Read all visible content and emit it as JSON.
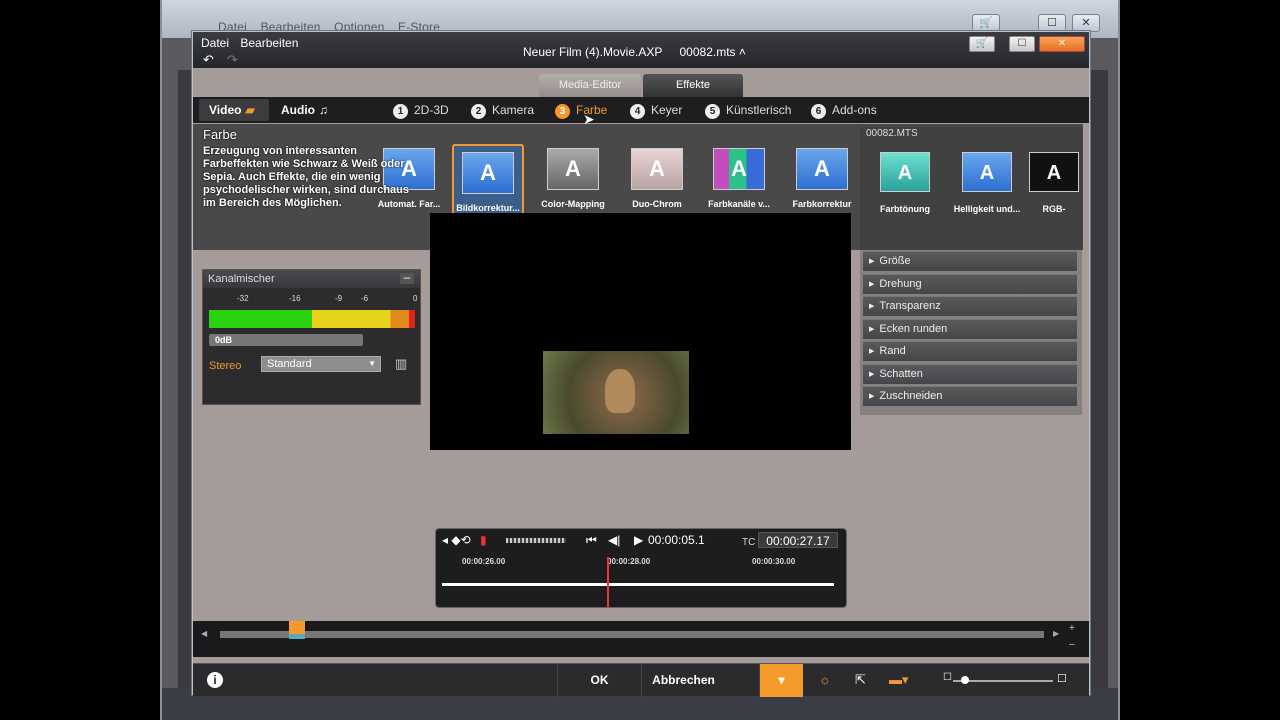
{
  "bg_window": {
    "menu": [
      "Datei",
      "Bearbeiten",
      "Optionen",
      "E-Store"
    ]
  },
  "title_bar": {
    "menu": [
      "Datei",
      "Bearbeiten"
    ],
    "project": "Neuer Film (4).Movie.AXP",
    "file": "00082.mts"
  },
  "tabs": {
    "media_editor": "Media-Editor",
    "effects": "Effekte"
  },
  "subbar": {
    "video": "Video",
    "audio": "Audio",
    "categories": [
      {
        "num": "1",
        "label": "2D-3D"
      },
      {
        "num": "2",
        "label": "Kamera"
      },
      {
        "num": "3",
        "label": "Farbe"
      },
      {
        "num": "4",
        "label": "Keyer"
      },
      {
        "num": "5",
        "label": "Künstlerisch"
      },
      {
        "num": "6",
        "label": "Add-ons"
      }
    ]
  },
  "tooltip": {
    "title": "Farbe",
    "body": "Erzeugung von interessanten Farbeffekten wie Schwarz & Weiß oder Sepia. Auch Effekte, die ein wenig psychodelischer wirken, sind durchaus im Bereich des Möglichen."
  },
  "effects": [
    {
      "label": "Automat. Far..."
    },
    {
      "label": "Bildkorrektur..."
    },
    {
      "label": "Color-Mapping"
    },
    {
      "label": "Duo-Chrom"
    },
    {
      "label": "Farbkanäle v..."
    },
    {
      "label": "Farbkorrektur"
    }
  ],
  "right_effects": [
    {
      "label": "Farbtönung"
    },
    {
      "label": "Helligkeit und..."
    },
    {
      "label": "RGB-"
    }
  ],
  "right_panel": {
    "title": "00082.MTS",
    "props": [
      "Größe",
      "Drehung",
      "Transparenz",
      "Ecken runden",
      "Rand",
      "Schatten",
      "Zuschneiden"
    ]
  },
  "channel_mixer": {
    "title": "Kanalmischer",
    "scale": [
      "-32",
      "-16",
      "-9",
      "-6",
      "0"
    ],
    "level": "0dB",
    "stereo_label": "Stereo",
    "stereo_value": "Standard"
  },
  "timeline": {
    "current": "00:00:05.1",
    "tc_label": "TC",
    "tc_value": "00:00:27.17",
    "ticks": [
      "00:00:26.00",
      "00:00:28.00",
      "00:00:30.00"
    ]
  },
  "footer": {
    "ok": "OK",
    "cancel": "Abbrechen"
  },
  "colors": {
    "accent": "#f39a2a",
    "frame": "#a59c9a"
  }
}
